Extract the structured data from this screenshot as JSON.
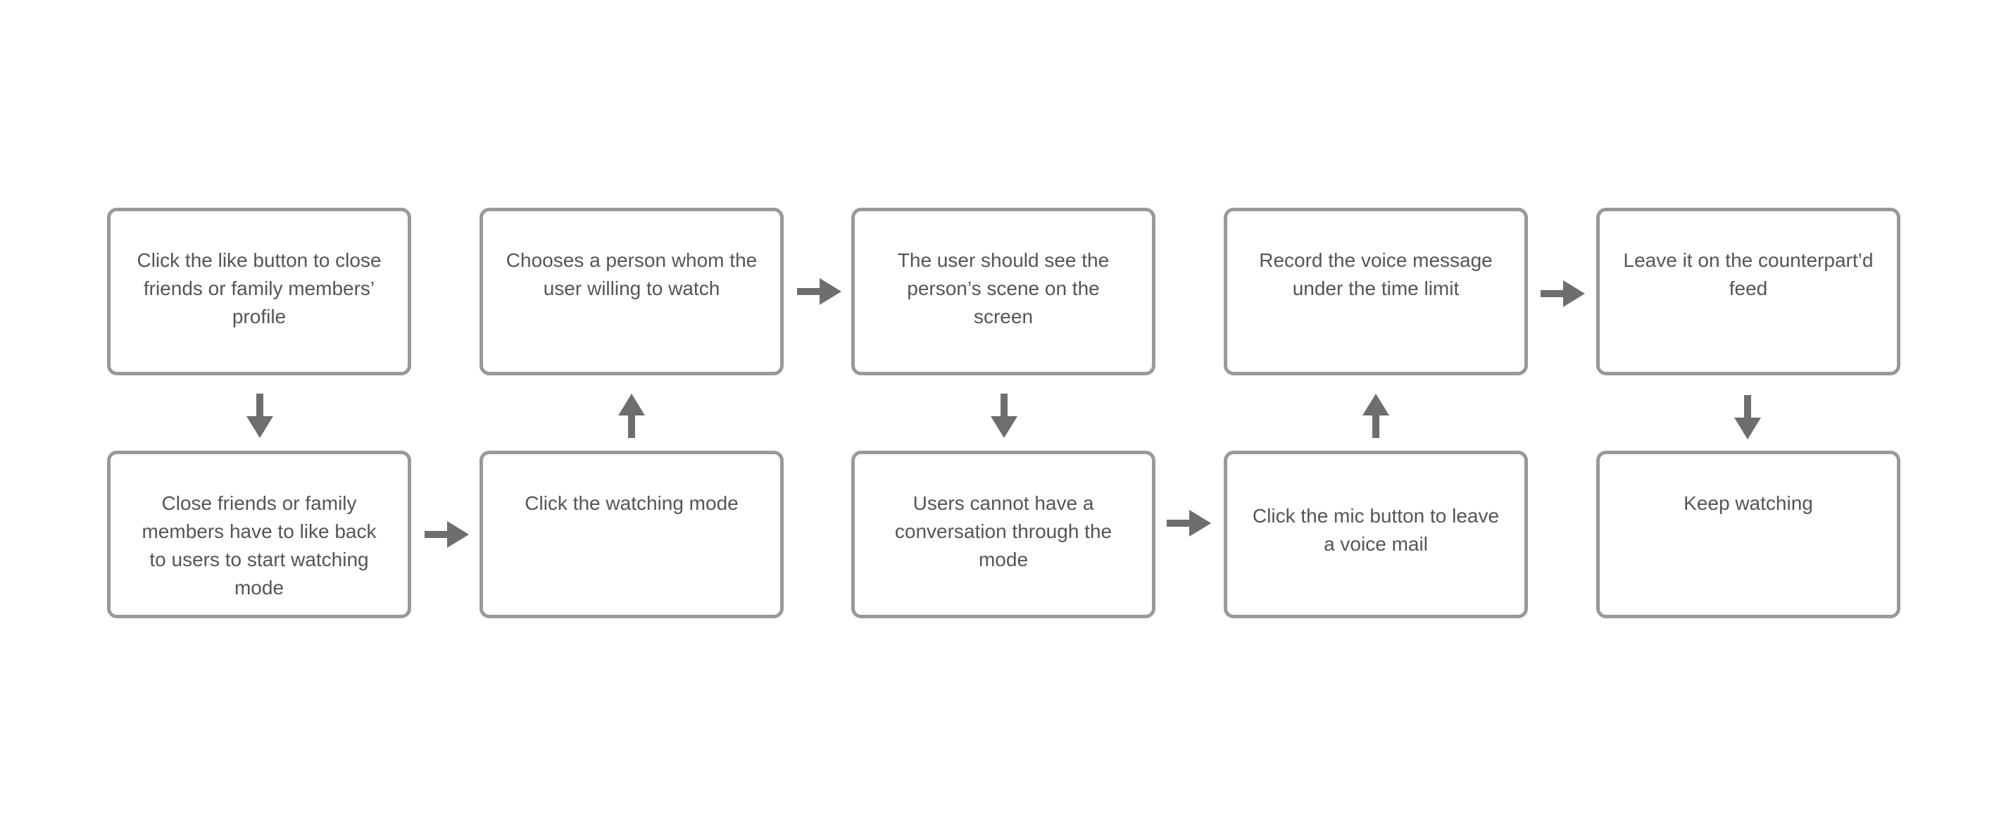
{
  "diagram": {
    "type": "flowchart",
    "colors": {
      "box_border": "#999999",
      "text": "#555555",
      "arrow": "#6e6e6e",
      "background": "#ffffff"
    },
    "steps": [
      {
        "id": "s1",
        "text": "Click the like button to close friends or family members’ profile"
      },
      {
        "id": "s2",
        "text": "Close friends or family members have to like back to users to start watching mode"
      },
      {
        "id": "s3",
        "text": "Click the watching mode"
      },
      {
        "id": "s4",
        "text": "Chooses a person whom the user willing to watch"
      },
      {
        "id": "s5",
        "text": "The user should see the person’s scene on the screen"
      },
      {
        "id": "s6",
        "text": "Users cannot have a conversation through the mode"
      },
      {
        "id": "s7",
        "text": "Click the mic button to leave a voice mail"
      },
      {
        "id": "s8",
        "text": "Record the voice message under the time limit"
      },
      {
        "id": "s9",
        "text": "Leave it on the counterpart’d feed"
      },
      {
        "id": "s10",
        "text": "Keep watching"
      }
    ],
    "edges": [
      {
        "from": "s1",
        "to": "s2",
        "direction": "down"
      },
      {
        "from": "s2",
        "to": "s3",
        "direction": "right"
      },
      {
        "from": "s3",
        "to": "s4",
        "direction": "up"
      },
      {
        "from": "s4",
        "to": "s5",
        "direction": "right"
      },
      {
        "from": "s5",
        "to": "s6",
        "direction": "down"
      },
      {
        "from": "s6",
        "to": "s7",
        "direction": "right"
      },
      {
        "from": "s7",
        "to": "s8",
        "direction": "up"
      },
      {
        "from": "s8",
        "to": "s9",
        "direction": "right"
      },
      {
        "from": "s9",
        "to": "s10",
        "direction": "down"
      }
    ]
  }
}
